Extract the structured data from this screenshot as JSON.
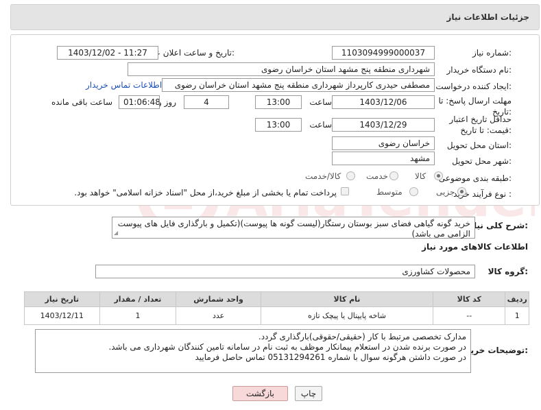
{
  "header": {
    "title": "جزئیات اطلاعات نیاز"
  },
  "form": {
    "need_number_label": "شماره نیاز:",
    "need_number": "1103094999000037",
    "announce_label": "تاریخ و ساعت اعلان عمومی:",
    "announce_value": "1403/12/02 - 11:27",
    "buyer_org_label": "نام دستگاه خریدار:",
    "buyer_org": "شهرداری منطقه پنج مشهد استان خراسان رضوی",
    "creator_label": "ایجاد کننده درخواست:",
    "creator": "مصطفی حیدری کارپرداز شهرداری منطقه پنج مشهد استان خراسان رضوی",
    "contact_link": "اطلاعات تماس خریدار",
    "reply_deadline_label": "مهلت ارسال پاسخ: تا تاریخ:",
    "reply_date": "1403/12/06",
    "time_label": "ساعت",
    "reply_time": "13:00",
    "days_count": "4",
    "days_label": "روز و",
    "remaining_time": "01:06:48",
    "remaining_label": "ساعت باقی مانده",
    "validity_label": "حداقل تاریخ اعتبار قیمت: تا تاریخ:",
    "validity_date": "1403/12/29",
    "validity_time": "13:00",
    "province_label": "استان محل تحویل:",
    "province": "خراسان رضوی",
    "city_label": "شهر محل تحویل:",
    "city": "مشهد",
    "category_label": "طبقه بندی موضوعی:",
    "category_options": [
      "کالا",
      "خدمت",
      "کالا/خدمت"
    ],
    "process_label": "نوع فرآیند خرید :",
    "process_options": [
      "جزیی",
      "متوسط"
    ],
    "payment_note": "پرداخت تمام یا بخشی از مبلغ خرید،از محل \"اسناد خزانه اسلامی\" خواهد بود."
  },
  "description": {
    "label": "شرح کلی نیاز:",
    "text": "خرید گونه گیاهی فضای سبز بوستان رستگار(لیست گونه ها پیوست)(تکمیل و بارگذاری فایل های پیوست الزامی می باشد)"
  },
  "goods_section": {
    "title": "اطلاعات کالاهای مورد نیاز",
    "group_label": "گروه کالا:",
    "group_value": "محصولات کشاورزی"
  },
  "table": {
    "headers": [
      "ردیف",
      "کد کالا",
      "نام کالا",
      "واحد شمارش",
      "تعداد / مقدار",
      "تاریخ نیاز"
    ],
    "rows": [
      [
        "1",
        "--",
        "شاخه پایپتال یا پیچک تازه",
        "عدد",
        "1",
        "1403/12/11"
      ]
    ]
  },
  "notes": {
    "label": "توضیحات خریدار:",
    "lines": [
      "مدارک تخصصی مرتبط با کار (حقیقی/حقوقی)بارگذاری گردد.",
      "در صورت برنده شدن در استعلام پیمانکار موظف به ثبت نام در سامانه تامین کنندگان شهرداری می باشد.",
      "در صورت داشتن هرگونه سوال  با شماره 05131294261 تماس حاصل فرمایید"
    ]
  },
  "buttons": {
    "back": "بازگشت",
    "print": "چاپ"
  },
  "colors": {
    "header_bg": "#e4e4e4",
    "link": "#1a4fb5",
    "back_btn": "#f7d9d9"
  }
}
